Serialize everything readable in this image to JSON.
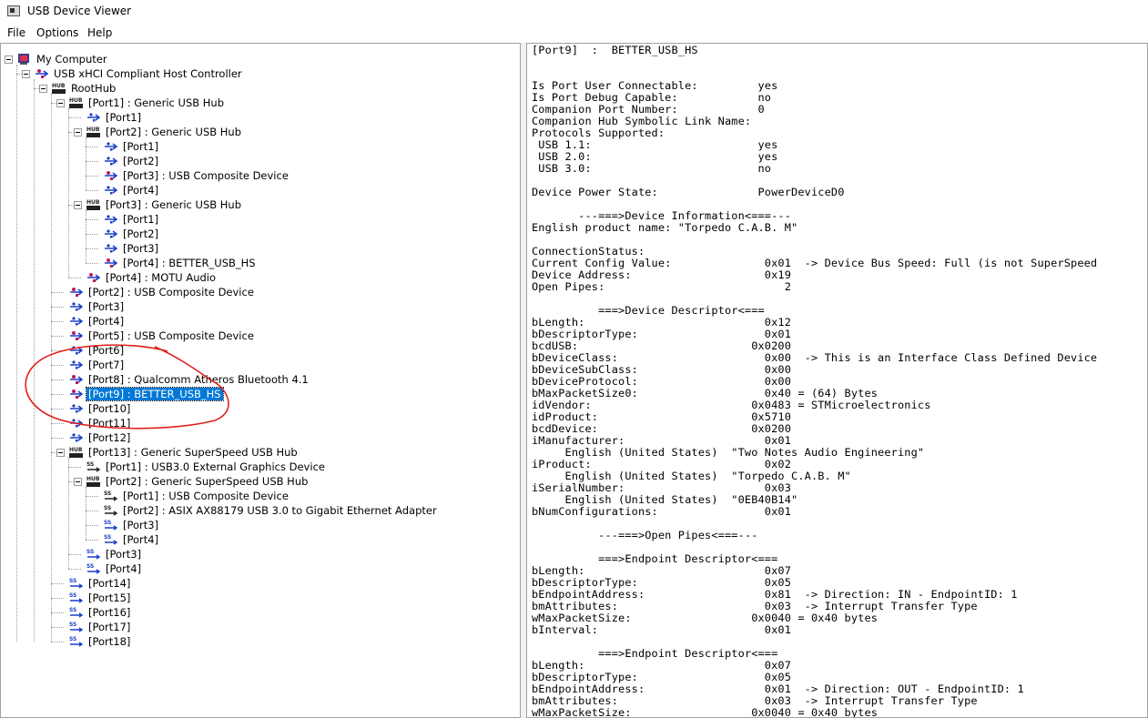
{
  "window": {
    "title": "USB Device Viewer"
  },
  "menu": [
    "File",
    "Options",
    "Help"
  ],
  "tree": [
    {
      "indent": 0,
      "label": "My Computer",
      "icon": "computer-icon",
      "toggle": true
    },
    {
      "indent": 1,
      "label": "USB xHCI Compliant Host Controller",
      "icon": "usb-controller-icon",
      "toggle": true
    },
    {
      "indent": 2,
      "label": "RootHub",
      "icon": "hub-icon",
      "toggle": true
    },
    {
      "indent": 3,
      "label": "[Port1]  :  Generic USB Hub",
      "icon": "hub-icon",
      "toggle": true
    },
    {
      "indent": 4,
      "label": "[Port1]",
      "icon": "usb-port-icon"
    },
    {
      "indent": 4,
      "label": "[Port2]  :  Generic USB Hub",
      "icon": "hub-icon",
      "toggle": true
    },
    {
      "indent": 5,
      "label": "[Port1]",
      "icon": "usb-port-icon"
    },
    {
      "indent": 5,
      "label": "[Port2]",
      "icon": "usb-port-icon"
    },
    {
      "indent": 5,
      "label": "[Port3]  :  USB Composite Device",
      "icon": "usb-device-icon"
    },
    {
      "indent": 5,
      "label": "[Port4]",
      "icon": "usb-port-icon"
    },
    {
      "indent": 4,
      "label": "[Port3]  :  Generic USB Hub",
      "icon": "hub-icon",
      "toggle": true
    },
    {
      "indent": 5,
      "label": "[Port1]",
      "icon": "usb-port-icon"
    },
    {
      "indent": 5,
      "label": "[Port2]",
      "icon": "usb-port-icon"
    },
    {
      "indent": 5,
      "label": "[Port3]",
      "icon": "usb-port-icon"
    },
    {
      "indent": 5,
      "label": "[Port4]  :  BETTER_USB_HS",
      "icon": "usb-device-icon"
    },
    {
      "indent": 4,
      "label": "[Port4]  :  MOTU Audio",
      "icon": "usb-device-icon"
    },
    {
      "indent": 3,
      "label": "[Port2]  :  USB Composite Device",
      "icon": "usb-device-icon"
    },
    {
      "indent": 3,
      "label": "[Port3]",
      "icon": "usb-port-icon"
    },
    {
      "indent": 3,
      "label": "[Port4]",
      "icon": "usb-port-icon"
    },
    {
      "indent": 3,
      "label": "[Port5]  :  USB Composite Device",
      "icon": "usb-device-icon"
    },
    {
      "indent": 3,
      "label": "[Port6]",
      "icon": "usb-port-icon"
    },
    {
      "indent": 3,
      "label": "[Port7]",
      "icon": "usb-port-icon"
    },
    {
      "indent": 3,
      "label": "[Port8]  :  Qualcomm Atheros Bluetooth 4.1",
      "icon": "usb-device-icon"
    },
    {
      "indent": 3,
      "label": "[Port9]  :  BETTER_USB_HS",
      "icon": "usb-device-icon",
      "selected": true
    },
    {
      "indent": 3,
      "label": "[Port10]",
      "icon": "usb-port-icon"
    },
    {
      "indent": 3,
      "label": "[Port11]",
      "icon": "usb-port-icon"
    },
    {
      "indent": 3,
      "label": "[Port12]",
      "icon": "usb-port-icon"
    },
    {
      "indent": 3,
      "label": "[Port13]  :  Generic SuperSpeed USB Hub",
      "icon": "hub-icon",
      "toggle": true
    },
    {
      "indent": 4,
      "label": "[Port1]  :  USB3.0 External Graphics Device",
      "icon": "superspeed-device-icon"
    },
    {
      "indent": 4,
      "label": "[Port2]  :  Generic SuperSpeed USB Hub",
      "icon": "hub-icon",
      "toggle": true
    },
    {
      "indent": 5,
      "label": "[Port1]  :  USB Composite Device",
      "icon": "superspeed-device-icon"
    },
    {
      "indent": 5,
      "label": "[Port2]  :  ASIX AX88179 USB 3.0 to Gigabit Ethernet Adapter",
      "icon": "superspeed-device-icon"
    },
    {
      "indent": 5,
      "label": "[Port3]",
      "icon": "superspeed-port-icon"
    },
    {
      "indent": 5,
      "label": "[Port4]",
      "icon": "superspeed-port-icon"
    },
    {
      "indent": 4,
      "label": "[Port3]",
      "icon": "superspeed-port-icon"
    },
    {
      "indent": 4,
      "label": "[Port4]",
      "icon": "superspeed-port-icon"
    },
    {
      "indent": 3,
      "label": "[Port14]",
      "icon": "superspeed-port-icon"
    },
    {
      "indent": 3,
      "label": "[Port15]",
      "icon": "superspeed-port-icon"
    },
    {
      "indent": 3,
      "label": "[Port16]",
      "icon": "superspeed-port-icon"
    },
    {
      "indent": 3,
      "label": "[Port17]",
      "icon": "superspeed-port-icon"
    },
    {
      "indent": 3,
      "label": "[Port18]",
      "icon": "superspeed-port-icon"
    }
  ],
  "details": [
    "[Port9]  :  BETTER_USB_HS",
    "",
    "",
    "Is Port User Connectable:         yes",
    "Is Port Debug Capable:            no",
    "Companion Port Number:            0",
    "Companion Hub Symbolic Link Name:",
    "Protocols Supported:",
    " USB 1.1:                         yes",
    " USB 2.0:                         yes",
    " USB 3.0:                         no",
    "",
    "Device Power State:               PowerDeviceD0",
    "",
    "       ---===>Device Information<===---",
    "English product name: \"Torpedo C.A.B. M\"",
    "",
    "ConnectionStatus:",
    "Current Config Value:              0x01  -> Device Bus Speed: Full (is not SuperSpeed",
    "Device Address:                    0x19",
    "Open Pipes:                           2",
    "",
    "          ===>Device Descriptor<===",
    "bLength:                           0x12",
    "bDescriptorType:                   0x01",
    "bcdUSB:                          0x0200",
    "bDeviceClass:                      0x00  -> This is an Interface Class Defined Device",
    "bDeviceSubClass:                   0x00",
    "bDeviceProtocol:                   0x00",
    "bMaxPacketSize0:                   0x40 = (64) Bytes",
    "idVendor:                        0x0483 = STMicroelectronics",
    "idProduct:                       0x5710",
    "bcdDevice:                       0x0200",
    "iManufacturer:                     0x01",
    "     English (United States)  \"Two Notes Audio Engineering\"",
    "iProduct:                          0x02",
    "     English (United States)  \"Torpedo C.A.B. M\"",
    "iSerialNumber:                     0x03",
    "     English (United States)  \"0EB40B14\"",
    "bNumConfigurations:                0x01",
    "",
    "          ---===>Open Pipes<===---",
    "",
    "          ===>Endpoint Descriptor<===",
    "bLength:                           0x07",
    "bDescriptorType:                   0x05",
    "bEndpointAddress:                  0x81  -> Direction: IN - EndpointID: 1",
    "bmAttributes:                      0x03  -> Interrupt Transfer Type",
    "wMaxPacketSize:                  0x0040 = 0x40 bytes",
    "bInterval:                         0x01",
    "",
    "          ===>Endpoint Descriptor<===",
    "bLength:                           0x07",
    "bDescriptorType:                   0x05",
    "bEndpointAddress:                  0x01  -> Direction: OUT - EndpointID: 1",
    "bmAttributes:                      0x03  -> Interrupt Transfer Type",
    "wMaxPacketSize:                  0x0040 = 0x40 bytes"
  ],
  "colors": {
    "selection": "#0078d7",
    "annotation": "#e0201c"
  }
}
